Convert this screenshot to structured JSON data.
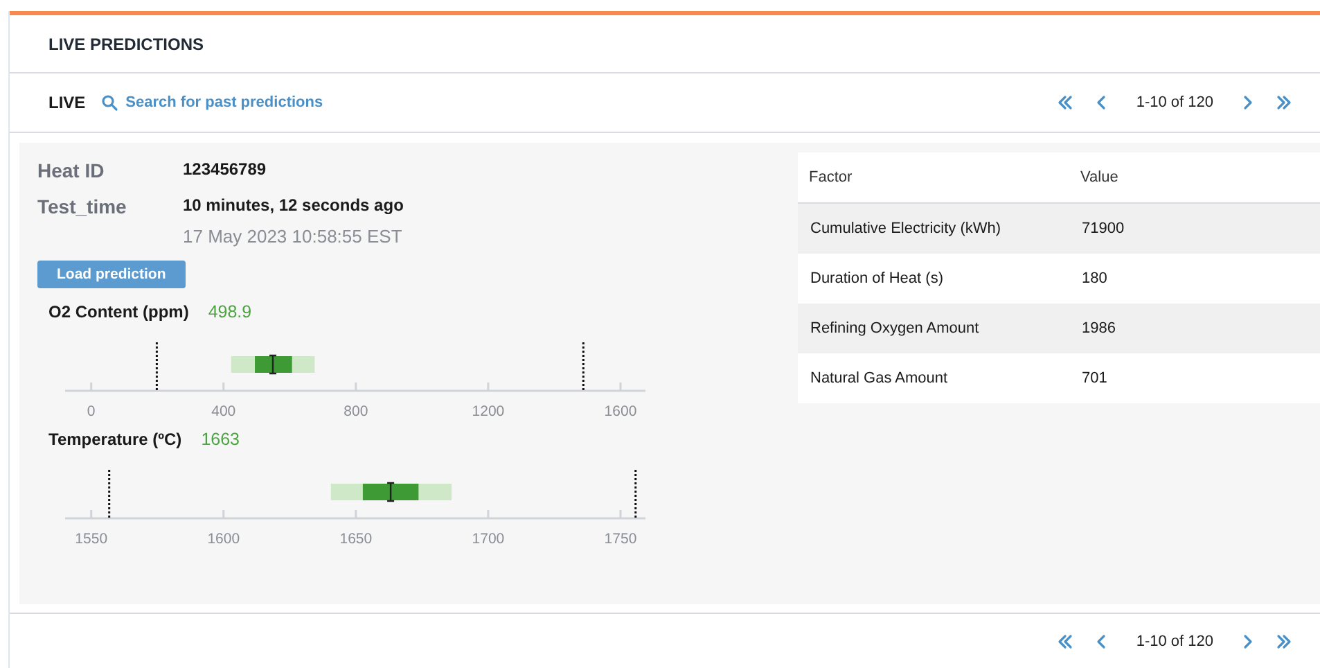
{
  "header": {
    "title": "LIVE PREDICTIONS"
  },
  "toolbar": {
    "live_label": "LIVE",
    "search_link": "Search for past predictions"
  },
  "pagination_top": {
    "range": "1-10 of 120"
  },
  "details": [
    {
      "label": "Heat ID",
      "value": "123456789"
    },
    {
      "label": "Test_time",
      "value": "10 minutes, 12 seconds ago",
      "subvalue": "17 May 2023 10:58:55 EST"
    }
  ],
  "load_button": "Load prediction",
  "gauges": [
    {
      "label": "O2 Content (ppm)",
      "reading": "498.9",
      "ticks": [
        "0",
        "400",
        "800",
        "1200",
        "1600"
      ],
      "marks": [
        {
          "kind": "band"
        },
        {
          "kind": "core"
        },
        {
          "kind": "limit"
        },
        {
          "kind": "limit"
        },
        {
          "kind": "marker"
        }
      ]
    },
    {
      "label": "Temperature (ºC)",
      "reading": "1663",
      "ticks": [
        "1550",
        "1600",
        "1650",
        "1700",
        "1750"
      ],
      "marks": [
        {
          "kind": "band"
        },
        {
          "kind": "core"
        },
        {
          "kind": "limit"
        },
        {
          "kind": "limit"
        },
        {
          "kind": "marker"
        }
      ]
    }
  ],
  "table": {
    "columns": [
      "Factor",
      "Value"
    ],
    "rows": [
      {
        "cells": [
          "Cumulative Electricity (kWh)",
          "71900"
        ]
      },
      {
        "cells": [
          "Duration of Heat (s)",
          "180"
        ]
      },
      {
        "cells": [
          "Refining Oxygen Amount",
          "1986"
        ]
      },
      {
        "cells": [
          "Natural Gas Amount",
          "701"
        ]
      }
    ]
  },
  "pagination_bottom": {
    "range": "1-10 of 120"
  }
}
